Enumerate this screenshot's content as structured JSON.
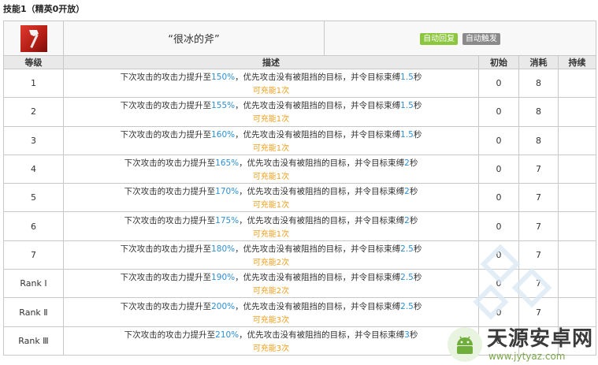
{
  "page_title": "技能1（精英0开放）",
  "skill": {
    "icon": "axe-icon",
    "name": "“很冰的斧”",
    "tags": [
      {
        "label": "自动回复",
        "color": "#8cc63f"
      },
      {
        "label": "自动触发",
        "color": "#8a8a8a"
      }
    ]
  },
  "columns": {
    "level": "等级",
    "description": "描述",
    "initial": "初始",
    "cost": "消耗",
    "duration": "持续"
  },
  "desc_parts": {
    "prefix": "下次攻击的攻击力提升至",
    "middle": "，优先攻击没有被阻挡的目标，并令目标束缚",
    "suffix": "秒"
  },
  "rows": [
    {
      "level": "1",
      "atk": "150%",
      "bind": "1.5",
      "charge": "可充能1次",
      "initial": "0",
      "cost": "8",
      "duration": ""
    },
    {
      "level": "2",
      "atk": "155%",
      "bind": "1.5",
      "charge": "可充能1次",
      "initial": "0",
      "cost": "8",
      "duration": ""
    },
    {
      "level": "3",
      "atk": "160%",
      "bind": "1.5",
      "charge": "可充能1次",
      "initial": "0",
      "cost": "8",
      "duration": ""
    },
    {
      "level": "4",
      "atk": "165%",
      "bind": "2",
      "charge": "可充能1次",
      "initial": "0",
      "cost": "7",
      "duration": ""
    },
    {
      "level": "5",
      "atk": "170%",
      "bind": "2",
      "charge": "可充能1次",
      "initial": "0",
      "cost": "7",
      "duration": ""
    },
    {
      "level": "6",
      "atk": "175%",
      "bind": "2",
      "charge": "可充能1次",
      "initial": "0",
      "cost": "7",
      "duration": ""
    },
    {
      "level": "7",
      "atk": "180%",
      "bind": "2.5",
      "charge": "可充能2次",
      "initial": "0",
      "cost": "7",
      "duration": ""
    },
    {
      "level": "Rank Ⅰ",
      "atk": "190%",
      "bind": "2.5",
      "charge": "可充能2次",
      "initial": "0",
      "cost": "7",
      "duration": ""
    },
    {
      "level": "Rank Ⅱ",
      "atk": "200%",
      "bind": "2.5",
      "charge": "可充能3次",
      "initial": "0",
      "cost": "7",
      "duration": ""
    },
    {
      "level": "Rank Ⅲ",
      "atk": "210%",
      "bind": "3",
      "charge": "可充能3次",
      "initial": "0",
      "cost": "7",
      "duration": ""
    }
  ],
  "watermark": {
    "title": "天源安卓网",
    "url": "www.jytyaz.com",
    "icon": "android-logo-icon"
  },
  "colors": {
    "highlight": "#2d8fd5",
    "charge": "#f0a020"
  }
}
